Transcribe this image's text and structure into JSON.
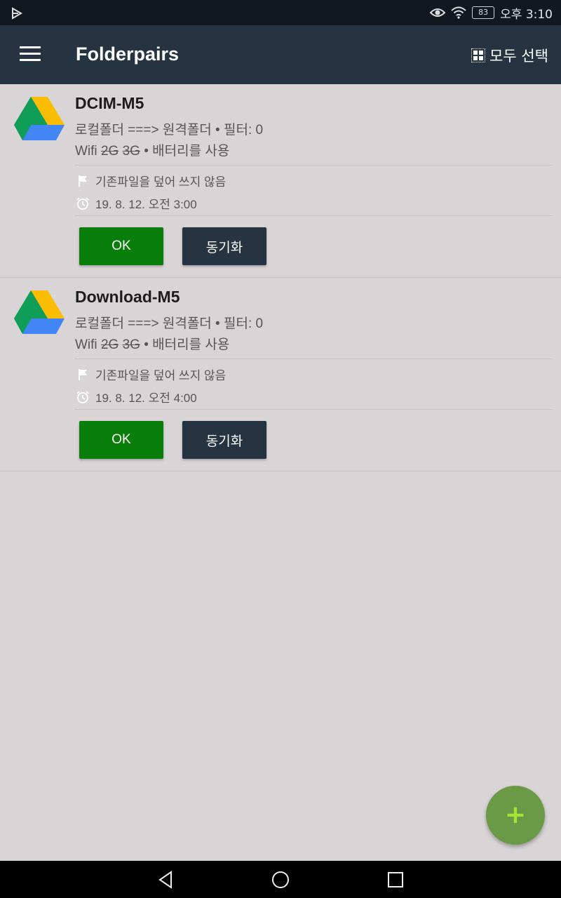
{
  "status_bar": {
    "time": "오후 3:10",
    "battery": "83"
  },
  "app_bar": {
    "title": "Folderpairs",
    "select_all": "모두 선택"
  },
  "folderpairs": [
    {
      "name": "DCIM-M5",
      "line1": "로컬폴더 ===> 원격폴더 • 필터: 0",
      "wifi": "Wifi",
      "net_2g": "2G",
      "net_3g": "3G",
      "battery_text": "• 배터리를 사용",
      "overwrite": "기존파일을 덮어 쓰지 않음",
      "schedule": "19. 8. 12. 오전 3:00",
      "ok_label": "OK",
      "sync_label": "동기화"
    },
    {
      "name": "Download-M5",
      "line1": "로컬폴더 ===> 원격폴더 • 필터: 0",
      "wifi": "Wifi",
      "net_2g": "2G",
      "net_3g": "3G",
      "battery_text": "• 배터리를 사용",
      "overwrite": "기존파일을 덮어 쓰지 않음",
      "schedule": "19. 8. 12. 오전 4:00",
      "ok_label": "OK",
      "sync_label": "동기화"
    }
  ],
  "fab": {
    "label": "+"
  },
  "colors": {
    "appbar": "#263442",
    "ok": "#0a7e0a",
    "fab": "#6a9a45"
  }
}
